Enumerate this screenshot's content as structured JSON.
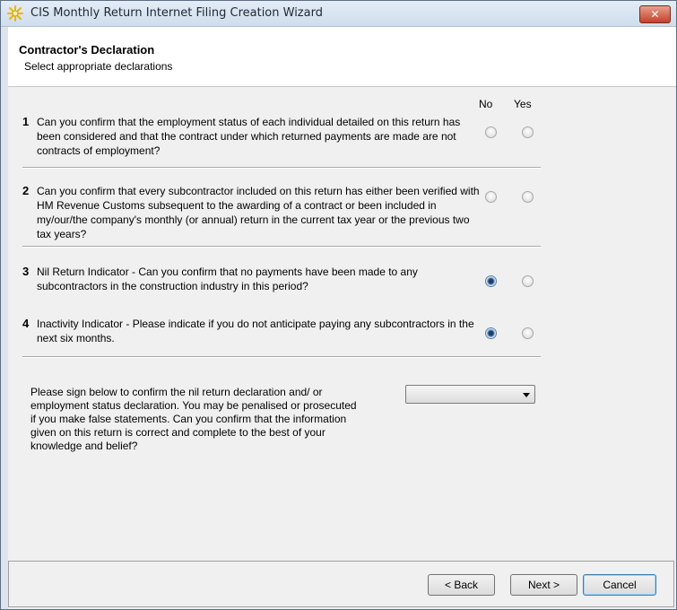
{
  "window": {
    "title": "CIS Monthly Return Internet Filing Creation Wizard",
    "close_label": "✕"
  },
  "header": {
    "title": "Contractor's Declaration",
    "subtitle": "Select appropriate declarations"
  },
  "columns": {
    "no": "No",
    "yes": "Yes"
  },
  "questions": [
    {
      "number": "1",
      "text": "Can you confirm that the employment status of each individual detailed on this return has been considered and that the contract under which returned payments are made are not contracts of employment?",
      "selected": "none"
    },
    {
      "number": "2",
      "text": "Can you confirm that every subcontractor included on this return has either been verified with HM Revenue  Customs subsequent to the awarding of a contract or been included in my/our/the company's monthly (or annual) return in the current tax year or the previous two tax years?",
      "selected": "none"
    },
    {
      "number": "3",
      "text": "Nil Return Indicator - Can you confirm that no payments have been made to any subcontractors in the construction industry in this period?",
      "selected": "no"
    },
    {
      "number": "4",
      "text": "Inactivity Indicator - Please indicate if you do not anticipate paying any subcontractors in the next six months.",
      "selected": "no"
    }
  ],
  "signature": {
    "text": "Please sign below to confirm the nil return declaration and/ or employment status declaration. You may be penalised or prosecuted if you make false statements. Can you confirm that the information given on this return is correct and complete to the best of your knowledge and belief?",
    "selected_value": ""
  },
  "buttons": {
    "back": "< Back",
    "next": "Next >",
    "cancel": "Cancel"
  },
  "colors": {
    "accent": "#3c7fb1",
    "close": "#c5402a"
  }
}
